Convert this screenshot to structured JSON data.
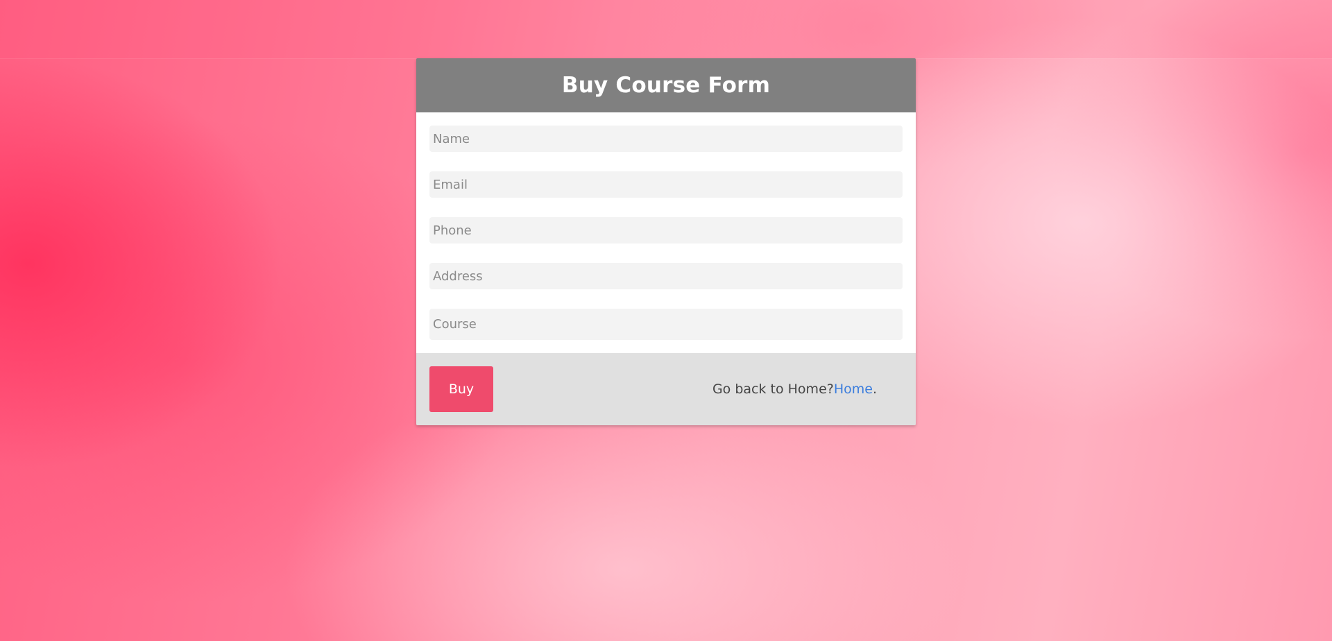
{
  "form": {
    "title": "Buy Course Form",
    "fields": {
      "name_placeholder": "Name",
      "email_placeholder": "Email",
      "phone_placeholder": "Phone",
      "address_placeholder": "Address",
      "course_placeholder": "Course"
    },
    "buy_label": "Buy",
    "home_prompt": "Go back to Home?",
    "home_link": "Home",
    "home_suffix": "."
  },
  "colors": {
    "header": "#808080",
    "button": "#ef4b6c",
    "footer": "#e0e0e0",
    "link": "#3b7ddd"
  }
}
